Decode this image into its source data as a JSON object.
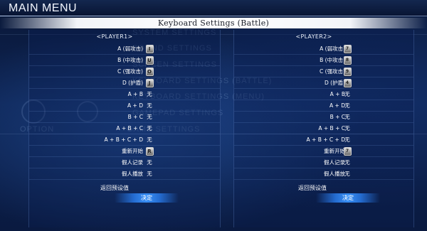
{
  "header": {
    "title": "MAIN MENU"
  },
  "settings_title": "Keyboard Settings (Battle)",
  "background_menu": [
    "SYSTEM SETTINGS",
    "SOUND SETTINGS",
    "SCREEN SETTINGS",
    "KEYBOARD SETTINGS (BATTLE)",
    "KEYBOARD SETTINGS (MENU)",
    "GAMEPAD SETTINGS",
    "GAME SETTINGS",
    "OPTION"
  ],
  "player1": {
    "label": "<PLAYER1>",
    "rows": [
      {
        "label": "A (弱攻击)",
        "value": "I",
        "type": "key"
      },
      {
        "label": "B (中攻击)",
        "value": "U",
        "type": "key"
      },
      {
        "label": "C (强攻击)",
        "value": "O",
        "type": "key"
      },
      {
        "label": "D (护盾)",
        "value": "J",
        "type": "key"
      },
      {
        "label": "A + B",
        "value": "无",
        "type": "text"
      },
      {
        "label": "A + D",
        "value": "无",
        "type": "text"
      },
      {
        "label": "B + C",
        "value": "无",
        "type": "text"
      },
      {
        "label": "A + B + C",
        "value": "无",
        "type": "text"
      },
      {
        "label": "A + B + C + D",
        "value": "无",
        "type": "text"
      },
      {
        "label": "重新开始",
        "value": "R",
        "type": "key"
      },
      {
        "label": "假人记录",
        "value": "无",
        "type": "text"
      },
      {
        "label": "假人播放",
        "value": "无",
        "type": "text"
      }
    ],
    "default_label": "返回预设值",
    "confirm_label": "决定"
  },
  "player2": {
    "label": "<PLAYER2>",
    "rows": [
      {
        "label": "A (弱攻击)",
        "value": "7",
        "type": "key"
      },
      {
        "label": "B (中攻击)",
        "value": "8",
        "type": "key"
      },
      {
        "label": "C (强攻击)",
        "value": "9",
        "type": "key"
      },
      {
        "label": "D (护盾)",
        "value": "4",
        "type": "key"
      },
      {
        "label": "A + B",
        "value": "无",
        "type": "text"
      },
      {
        "label": "A + D",
        "value": "无",
        "type": "text"
      },
      {
        "label": "B + C",
        "value": "无",
        "type": "text"
      },
      {
        "label": "A + B + C",
        "value": "无",
        "type": "text"
      },
      {
        "label": "A + B + C + D",
        "value": "无",
        "type": "text"
      },
      {
        "label": "重新开始",
        "value": "7",
        "type": "key"
      },
      {
        "label": "假人记录",
        "value": "无",
        "type": "text"
      },
      {
        "label": "假人播放",
        "value": "无",
        "type": "text"
      }
    ],
    "default_label": "返回预设值",
    "confirm_label": "决定"
  },
  "colors": {
    "background": "#0d2352",
    "highlight": "#3c96ff",
    "title_bar": "#ffffff",
    "text": "#ffffff"
  }
}
